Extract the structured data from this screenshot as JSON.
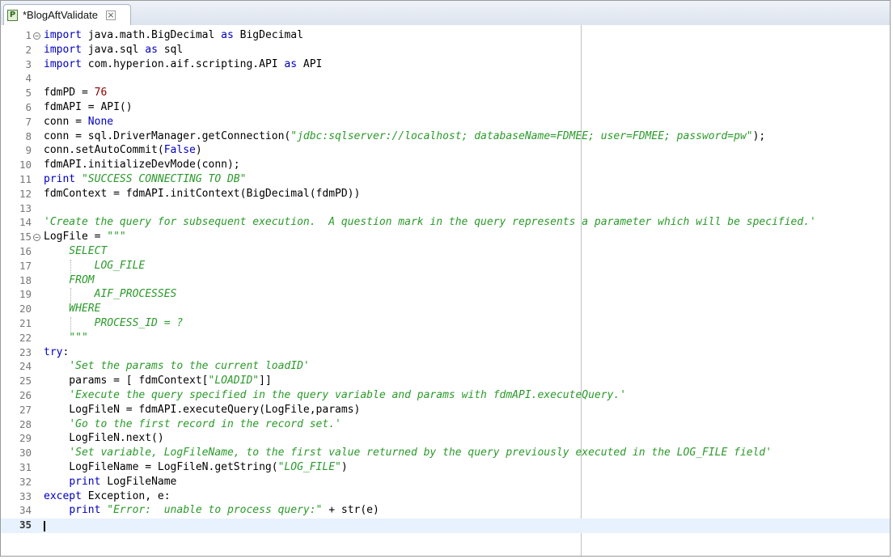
{
  "tab": {
    "title": "*BlogAftValidate",
    "icon": "python-file-icon",
    "close": "⊠"
  },
  "editor": {
    "current_line": 35,
    "lines": [
      {
        "n": "1",
        "fold": "−",
        "segs": [
          [
            "kw",
            "import"
          ],
          [
            "p",
            " java.math.BigDecimal "
          ],
          [
            "kw",
            "as"
          ],
          [
            "p",
            " BigDecimal"
          ]
        ]
      },
      {
        "n": "2",
        "segs": [
          [
            "kw",
            "import"
          ],
          [
            "p",
            " java.sql "
          ],
          [
            "kw",
            "as"
          ],
          [
            "p",
            " sql"
          ]
        ]
      },
      {
        "n": "3",
        "segs": [
          [
            "kw",
            "import"
          ],
          [
            "p",
            " com.hyperion.aif.scripting.API "
          ],
          [
            "kw",
            "as"
          ],
          [
            "p",
            " API"
          ]
        ]
      },
      {
        "n": "4",
        "segs": []
      },
      {
        "n": "5",
        "segs": [
          [
            "p",
            "fdmPD = "
          ],
          [
            "num",
            "76"
          ]
        ]
      },
      {
        "n": "6",
        "segs": [
          [
            "p",
            "fdmAPI = API()"
          ]
        ]
      },
      {
        "n": "7",
        "segs": [
          [
            "p",
            "conn = "
          ],
          [
            "kw",
            "None"
          ]
        ]
      },
      {
        "n": "8",
        "segs": [
          [
            "p",
            "conn = sql.DriverManager.getConnection("
          ],
          [
            "str",
            "\"jdbc:sqlserver://localhost; databaseName=FDMEE; user=FDMEE; password=pw\""
          ],
          [
            "p",
            ");"
          ]
        ]
      },
      {
        "n": "9",
        "segs": [
          [
            "p",
            "conn.setAutoCommit("
          ],
          [
            "kw",
            "False"
          ],
          [
            "p",
            ")"
          ]
        ]
      },
      {
        "n": "10",
        "segs": [
          [
            "p",
            "fdmAPI.initializeDevMode(conn);"
          ]
        ]
      },
      {
        "n": "11",
        "segs": [
          [
            "kw",
            "print"
          ],
          [
            "p",
            " "
          ],
          [
            "str",
            "\"SUCCESS CONNECTING TO DB\""
          ]
        ]
      },
      {
        "n": "12",
        "segs": [
          [
            "p",
            "fdmContext = fdmAPI.initContext(BigDecimal(fdmPD))"
          ]
        ]
      },
      {
        "n": "13",
        "segs": []
      },
      {
        "n": "14",
        "segs": [
          [
            "str",
            "'Create the query for subsequent execution.  A question mark in the query represents a parameter which will be specified.'"
          ]
        ]
      },
      {
        "n": "15",
        "fold": "−",
        "segs": [
          [
            "p",
            "LogFile = "
          ],
          [
            "str",
            "\"\"\""
          ]
        ]
      },
      {
        "n": "16",
        "segs": [
          [
            "str",
            "    SELECT"
          ]
        ]
      },
      {
        "n": "17",
        "guide": true,
        "segs": [
          [
            "str",
            "        LOG_FILE"
          ]
        ]
      },
      {
        "n": "18",
        "segs": [
          [
            "str",
            "    FROM"
          ]
        ]
      },
      {
        "n": "19",
        "guide": true,
        "segs": [
          [
            "str",
            "        AIF_PROCESSES"
          ]
        ]
      },
      {
        "n": "20",
        "segs": [
          [
            "str",
            "    WHERE"
          ]
        ]
      },
      {
        "n": "21",
        "guide": true,
        "segs": [
          [
            "str",
            "        PROCESS_ID = ?"
          ]
        ]
      },
      {
        "n": "22",
        "segs": [
          [
            "str",
            "    \"\"\""
          ]
        ]
      },
      {
        "n": "23",
        "segs": [
          [
            "kw",
            "try"
          ],
          [
            "p",
            ":"
          ]
        ]
      },
      {
        "n": "24",
        "segs": [
          [
            "p",
            "    "
          ],
          [
            "str",
            "'Set the params to the current loadID'"
          ]
        ]
      },
      {
        "n": "25",
        "segs": [
          [
            "p",
            "    params = [ fdmContext["
          ],
          [
            "str",
            "\"LOADID\""
          ],
          [
            "p",
            "]]"
          ]
        ]
      },
      {
        "n": "26",
        "segs": [
          [
            "p",
            "    "
          ],
          [
            "str",
            "'Execute the query specified in the query variable and params with fdmAPI.executeQuery.'"
          ]
        ]
      },
      {
        "n": "27",
        "segs": [
          [
            "p",
            "    LogFileN = fdmAPI.executeQuery(LogFile,params)"
          ]
        ]
      },
      {
        "n": "28",
        "segs": [
          [
            "p",
            "    "
          ],
          [
            "str",
            "'Go to the first record in the record set.'"
          ]
        ]
      },
      {
        "n": "29",
        "segs": [
          [
            "p",
            "    LogFileN.next()"
          ]
        ]
      },
      {
        "n": "30",
        "segs": [
          [
            "p",
            "    "
          ],
          [
            "str",
            "'Set variable, LogFileName, to the first value returned by the query previously executed in the LOG_FILE field'"
          ]
        ]
      },
      {
        "n": "31",
        "segs": [
          [
            "p",
            "    LogFileName = LogFileN.getString("
          ],
          [
            "str",
            "\"LOG_FILE\""
          ],
          [
            "p",
            ")"
          ]
        ]
      },
      {
        "n": "32",
        "segs": [
          [
            "p",
            "    "
          ],
          [
            "kw",
            "print"
          ],
          [
            "p",
            " LogFileName"
          ]
        ]
      },
      {
        "n": "33",
        "segs": [
          [
            "kw",
            "except"
          ],
          [
            "p",
            " Exception, e:"
          ]
        ]
      },
      {
        "n": "34",
        "segs": [
          [
            "p",
            "    "
          ],
          [
            "kw",
            "print"
          ],
          [
            "p",
            " "
          ],
          [
            "str",
            "\"Error:  unable to process query:\""
          ],
          [
            "p",
            " + str(e)"
          ]
        ]
      },
      {
        "n": "35",
        "segs": []
      }
    ]
  }
}
